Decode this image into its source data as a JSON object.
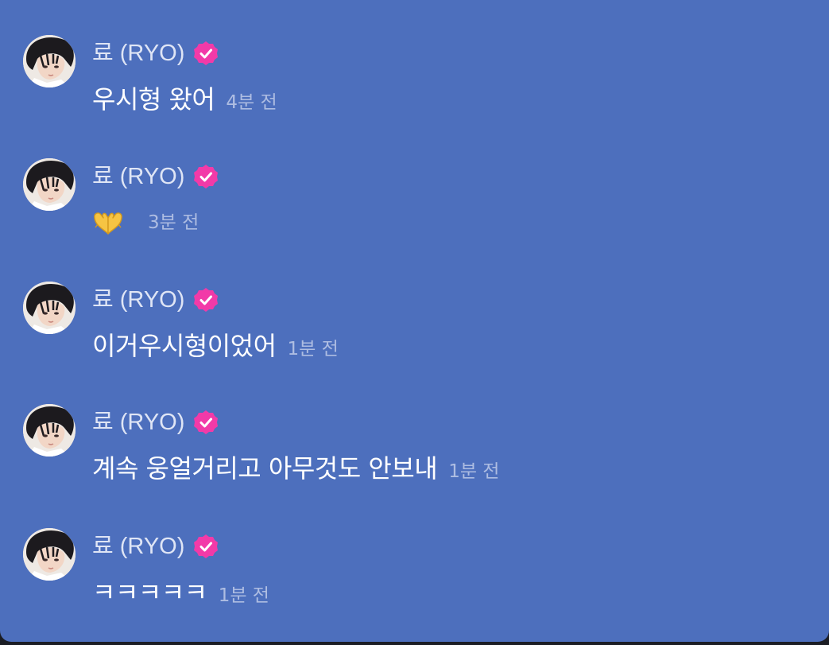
{
  "chat": {
    "messages": [
      {
        "sender": "료 (RYO)",
        "verified": true,
        "text": "우시형 왔어",
        "time": "4분 전",
        "type": "text"
      },
      {
        "sender": "료 (RYO)",
        "verified": true,
        "text": "",
        "emoji": "heart-hands-emoji",
        "time": "3분 전",
        "type": "emoji"
      },
      {
        "sender": "료 (RYO)",
        "verified": true,
        "text": "이거우시형이었어",
        "time": "1분 전",
        "type": "text"
      },
      {
        "sender": "료 (RYO)",
        "verified": true,
        "text": "계속 웅얼거리고 아무것도 안보내",
        "time": "1분 전",
        "type": "text"
      },
      {
        "sender": "료 (RYO)",
        "verified": true,
        "text": "ㅋㅋㅋㅋㅋ",
        "time": "1분 전",
        "type": "text"
      }
    ]
  },
  "colors": {
    "background": "#4d6fbd",
    "verified_badge": "#f23aa8",
    "message_text": "#ffffff",
    "meta_text": "#aebde2"
  }
}
